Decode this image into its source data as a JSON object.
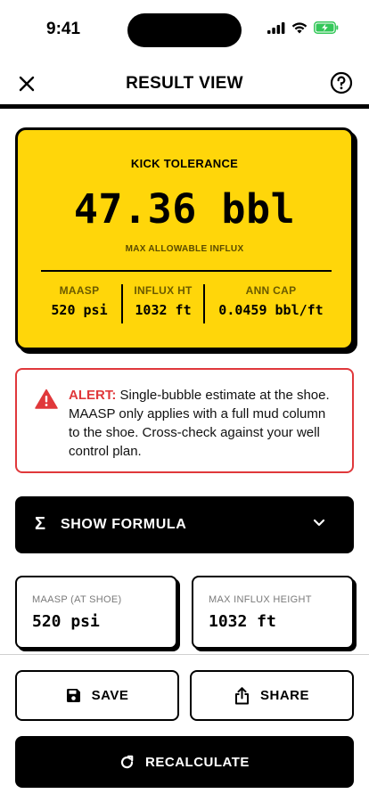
{
  "status_bar": {
    "time": "9:41"
  },
  "header": {
    "title": "RESULT VIEW"
  },
  "result": {
    "label": "KICK TOLERANCE",
    "value": "47.36 bbl",
    "sublabel": "MAX ALLOWABLE INFLUX",
    "stats": [
      {
        "label": "MAASP",
        "value": "520 psi"
      },
      {
        "label": "INFLUX HT",
        "value": "1032 ft"
      },
      {
        "label": "ANN CAP",
        "value": "0.0459 bbl/ft"
      }
    ]
  },
  "alert": {
    "prefix": "ALERT:",
    "message": " Single-bubble estimate at the shoe. MAASP only applies with a full mud column to the shoe. Cross-check against your well control plan."
  },
  "formula": {
    "label": "SHOW FORMULA",
    "icon": "sigma"
  },
  "mini_cards": [
    {
      "label": "MAASP (AT SHOE)",
      "value": "520 psi"
    },
    {
      "label": "MAX INFLUX HEIGHT",
      "value": "1032 ft"
    }
  ],
  "actions": {
    "save": "SAVE",
    "share": "SHARE",
    "recalculate": "RECALCULATE"
  },
  "colors": {
    "accent_yellow": "#FFD60A",
    "alert_red": "#E0383B",
    "battery_green": "#34C759"
  }
}
